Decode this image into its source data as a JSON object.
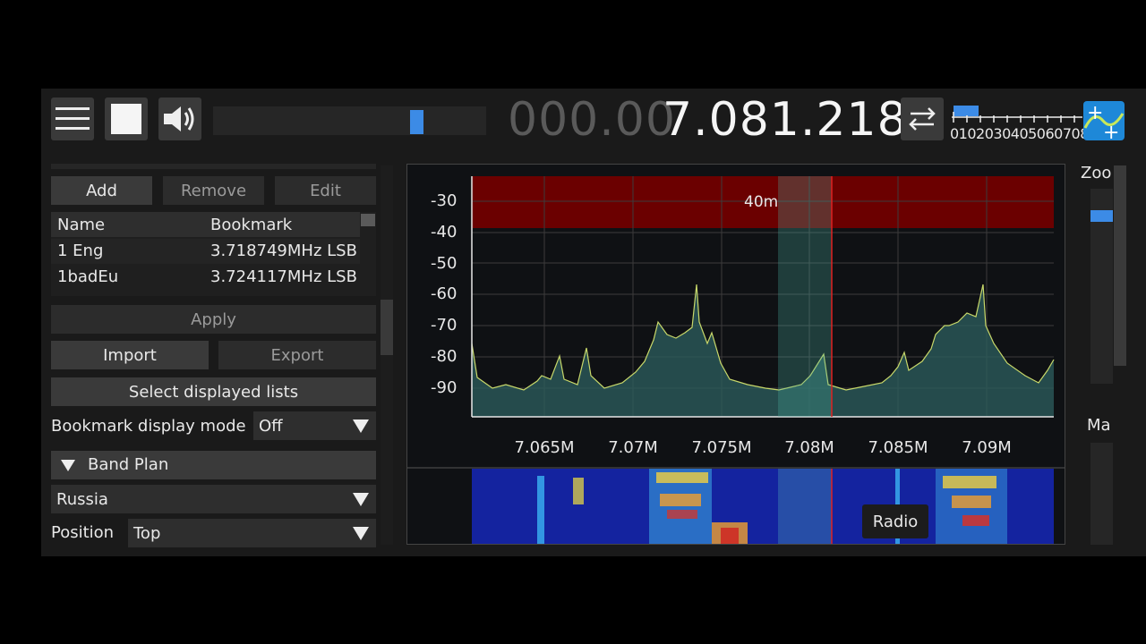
{
  "toolbar": {
    "menu_icon": "hamburger-menu-icon",
    "stop_icon": "stop-square-icon",
    "volume_icon": "speaker-icon",
    "volume_level": 0.76,
    "frequency_dim": "000.00",
    "frequency_bright": "7.081.218",
    "swap_icon": "swap-arrows-icon",
    "step_scale_labels": "0102030405060708090",
    "logo_icon": "sdr-plus-logo-icon"
  },
  "bookmarks": {
    "add_label": "Add",
    "remove_label": "Remove",
    "edit_label": "Edit",
    "columns": [
      "Name",
      "Bookmark"
    ],
    "rows": [
      {
        "name": "1 Eng",
        "bookmark": "3.718749MHz LSB"
      },
      {
        "name": "1badEu",
        "bookmark": "3.724117MHz LSB"
      }
    ],
    "apply_label": "Apply",
    "import_label": "Import",
    "export_label": "Export",
    "select_lists_label": "Select displayed lists",
    "display_mode_label": "Bookmark display mode",
    "display_mode_value": "Off"
  },
  "band_plan": {
    "header": "Band Plan",
    "region": "Russia",
    "position_label": "Position",
    "position_value": "Top"
  },
  "spectrum": {
    "band_label": "40m",
    "y_ticks": [
      "-30",
      "-40",
      "-50",
      "-60",
      "-70",
      "-80",
      "-90"
    ],
    "x_ticks": [
      "7.065M",
      "7.07M",
      "7.075M",
      "7.08M",
      "7.085M",
      "7.09M"
    ],
    "waterfall_tooltip": "Radio",
    "colors": {
      "band": "#6b0000",
      "trace": "#c8d86a",
      "fill": "#2a5a5a",
      "vfo_line": "#e02020"
    }
  },
  "side": {
    "zoom_label": "Zoo",
    "max_label": "Ma"
  }
}
